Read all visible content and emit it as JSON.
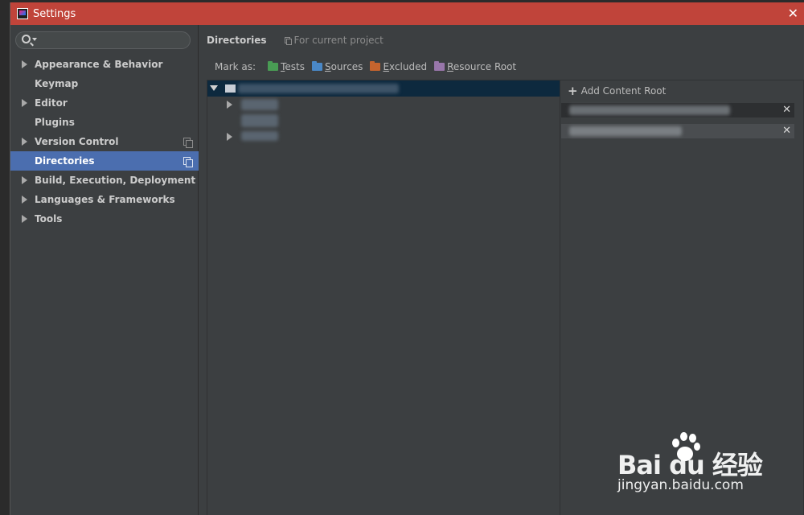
{
  "window": {
    "title": "Settings",
    "close_glyph": "✕"
  },
  "search": {
    "placeholder": "",
    "value": ""
  },
  "sidebar": {
    "items": [
      {
        "label": "Appearance & Behavior",
        "expandable": true,
        "selected": false,
        "project_icon": false
      },
      {
        "label": "Keymap",
        "expandable": false,
        "selected": false,
        "project_icon": false
      },
      {
        "label": "Editor",
        "expandable": true,
        "selected": false,
        "project_icon": false
      },
      {
        "label": "Plugins",
        "expandable": false,
        "selected": false,
        "project_icon": false
      },
      {
        "label": "Version Control",
        "expandable": true,
        "selected": false,
        "project_icon": true
      },
      {
        "label": "Directories",
        "expandable": false,
        "selected": true,
        "project_icon": true
      },
      {
        "label": "Build, Execution, Deployment",
        "expandable": true,
        "selected": false,
        "project_icon": false
      },
      {
        "label": "Languages & Frameworks",
        "expandable": true,
        "selected": false,
        "project_icon": false
      },
      {
        "label": "Tools",
        "expandable": true,
        "selected": false,
        "project_icon": false
      }
    ]
  },
  "main": {
    "title": "Directories",
    "scope": "For current project",
    "mark_as": {
      "label": "Mark as:",
      "buttons": [
        {
          "label": "Tests",
          "color": "#499c54"
        },
        {
          "label": "Sources",
          "color": "#4a88c7"
        },
        {
          "label": "Excluded",
          "color": "#c5642e"
        },
        {
          "label": "Resource Root",
          "color": "#9876aa"
        }
      ]
    },
    "content_roots": {
      "add_label": "Add Content Root",
      "remove_glyph": "✕"
    }
  },
  "colors": {
    "titlebar": "#c0443a",
    "selection": "#4b6eaf",
    "tree_selection": "#0d293e",
    "background": "#3c3f41"
  },
  "watermark": {
    "brand": "Bai  du 经验",
    "url": "jingyan.baidu.com"
  }
}
